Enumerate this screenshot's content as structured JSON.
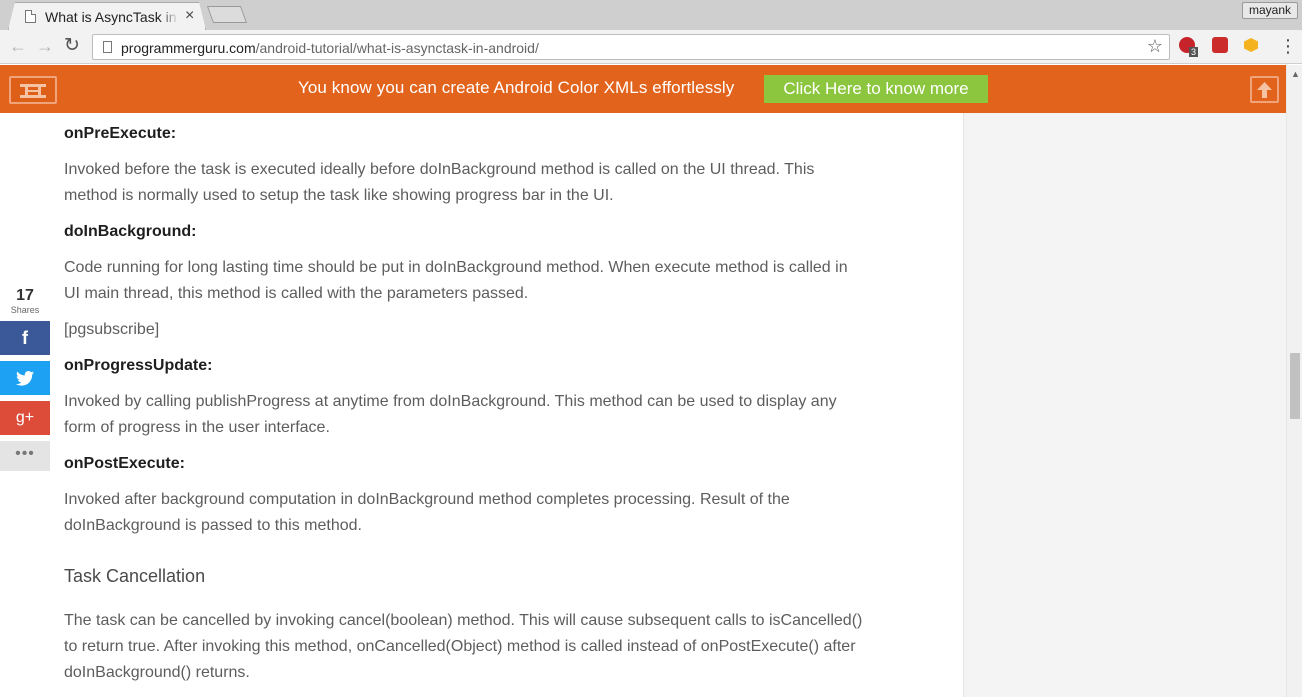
{
  "browser": {
    "tab": {
      "title": "What is AsyncTask in Android",
      "close": "×"
    },
    "profile_name": "mayank",
    "nav": {
      "back": "←",
      "forward": "→",
      "reload": "↻"
    },
    "address": {
      "host": "programmerguru.com",
      "path": "/android-tutorial/what-is-asynctask-in-android/"
    },
    "bookmark_star": "☆",
    "extensions": {
      "adblock_badge": "3"
    },
    "menu": "⋮"
  },
  "banner": {
    "text": "You know you can create Android Color XMLs effortlessly",
    "button_label": "Click Here to know more",
    "colors": {
      "background": "#e2631c",
      "button": "#8cc63f"
    }
  },
  "share": {
    "count": "17",
    "count_label": "Shares",
    "facebook": "f",
    "googleplus": "g+",
    "more": "•••",
    "colors": {
      "facebook": "#3b5998",
      "twitter": "#1da1f2",
      "googleplus": "#dd4b39"
    }
  },
  "article": {
    "pre_execute": {
      "heading": "onPreExecute:",
      "lines": [
        "Invoked before the task is executed ideally before doInBackground method is called on the UI thread. This",
        "method is normally used to setup the task like showing progress bar in the UI."
      ]
    },
    "do_in_background": {
      "heading": "doInBackground:",
      "lines": [
        "Code running for long lasting time should be put in doInBackground method. When execute method is called in",
        "UI main thread, this method is called with the parameters passed."
      ]
    },
    "shortcode": "[pgsubscribe]",
    "progress_update": {
      "heading": "onProgressUpdate:",
      "lines": [
        "Invoked by calling publishProgress at anytime from doInBackground. This method can be used to display any",
        "form of progress in the user interface."
      ]
    },
    "post_execute": {
      "heading": "onPostExecute:",
      "lines": [
        "Invoked after background computation in doInBackground method completes processing. Result of the",
        "doInBackground is passed to this method."
      ]
    },
    "cancellation": {
      "title": "Task Cancellation",
      "lines": [
        "The task can be cancelled by invoking cancel(boolean) method. This will cause subsequent calls to isCancelled()",
        "to return true. After invoking this method, onCancelled(Object) method is called instead of onPostExecute() after",
        "doInBackground() returns."
      ]
    }
  }
}
